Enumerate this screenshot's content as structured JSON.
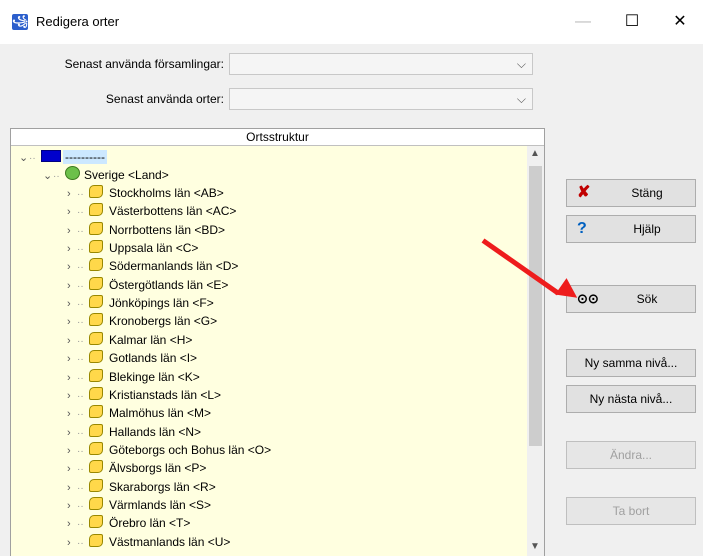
{
  "window": {
    "title": "Redigera orter",
    "minimize": "—",
    "maximize": "☐",
    "close": "✕"
  },
  "form": {
    "recent_parishes_label": "Senast använda församlingar:",
    "recent_places_label": "Senast använda orter:"
  },
  "tree": {
    "header": "Ortsstruktur",
    "root_label": "----------",
    "country_label": "Sverige <Land>",
    "items": [
      "Stockholms län <AB>",
      "Västerbottens län <AC>",
      "Norrbottens län <BD>",
      "Uppsala län <C>",
      "Södermanlands län <D>",
      "Östergötlands län <E>",
      "Jönköpings län <F>",
      "Kronobergs län <G>",
      "Kalmar län <H>",
      "Gotlands län <I>",
      "Blekinge län <K>",
      "Kristianstads län <L>",
      "Malmöhus län <M>",
      "Hallands län <N>",
      "Göteborgs och Bohus län <O>",
      "Älvsborgs län <P>",
      "Skaraborgs län <R>",
      "Värmlands län <S>",
      "Örebro län <T>",
      "Västmanlands län <U>"
    ]
  },
  "buttons": {
    "close": "Stäng",
    "help": "Hjälp",
    "search": "Sök",
    "new_same": "Ny samma nivå...",
    "new_next": "Ny nästa nivå...",
    "edit": "Ändra...",
    "delete": "Ta bort"
  },
  "annotation_color": "#ee1c1c"
}
